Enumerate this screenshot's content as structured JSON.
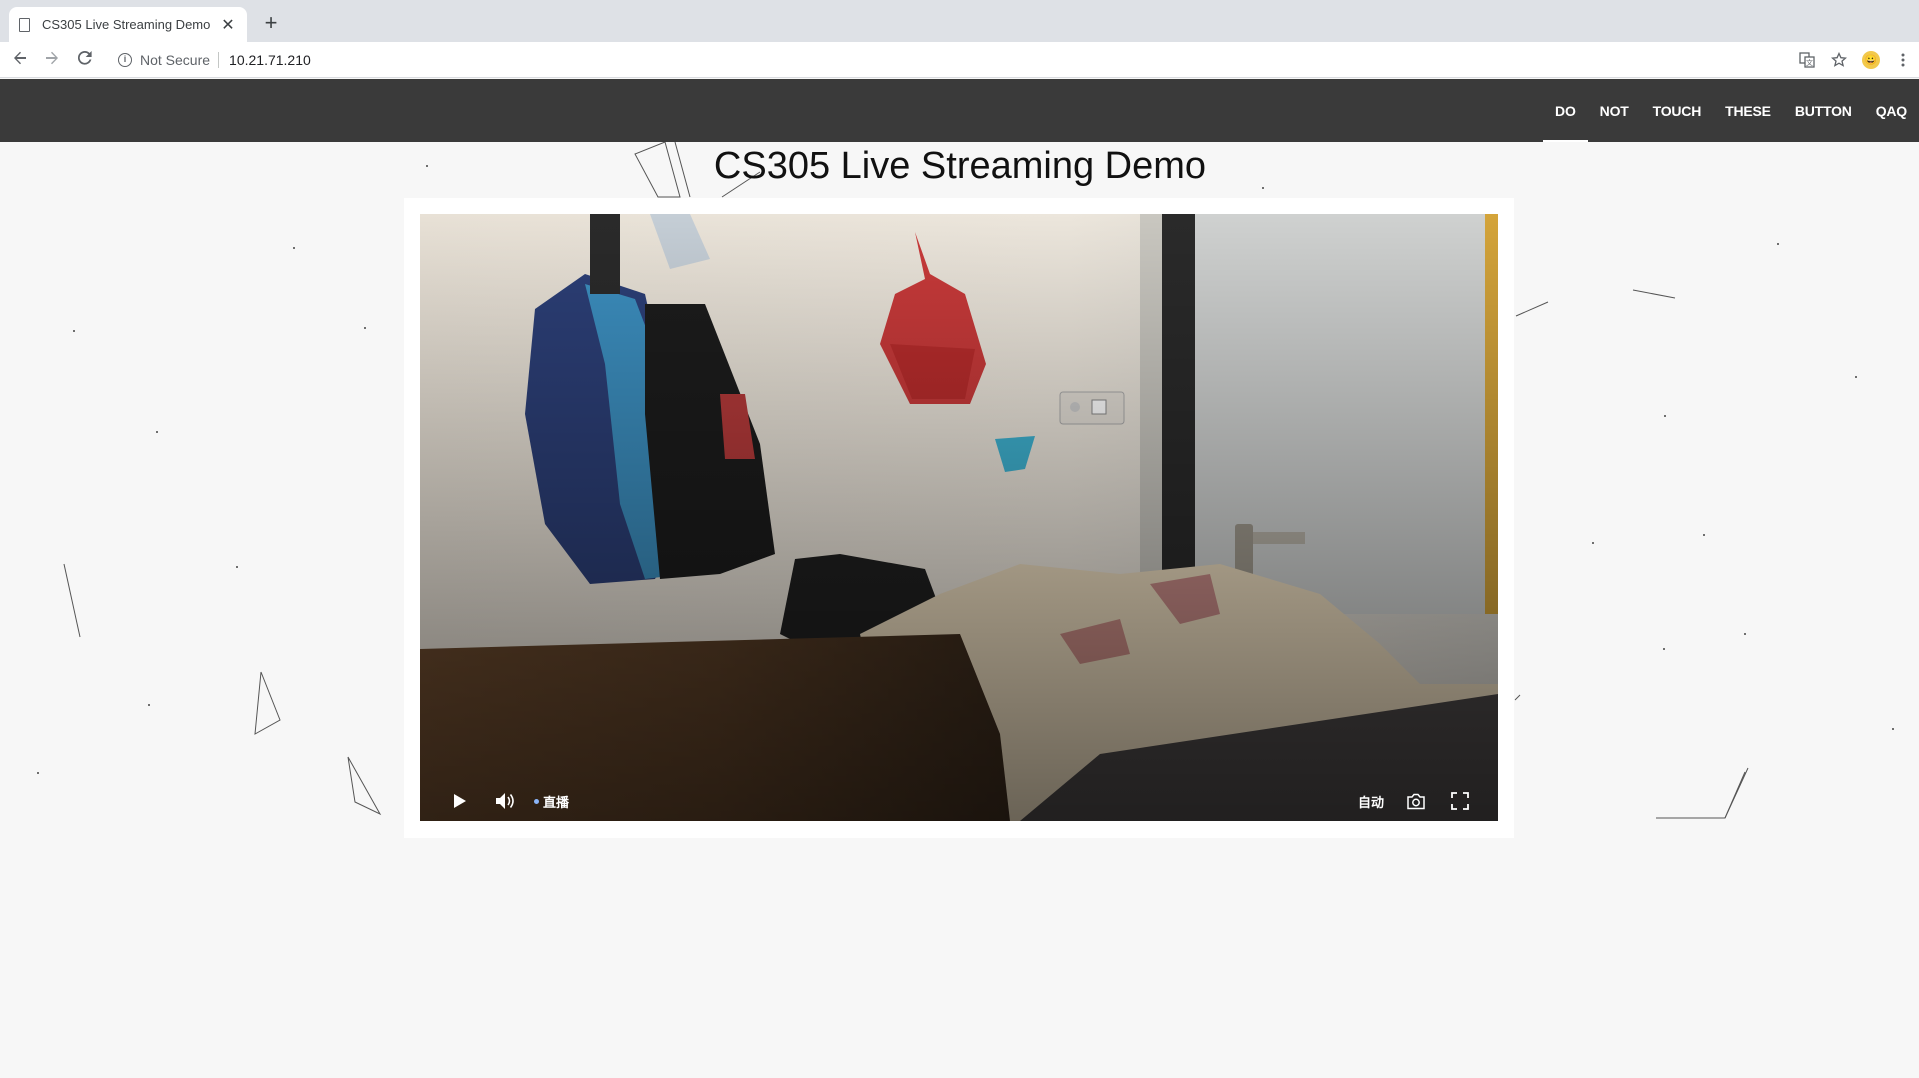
{
  "browser": {
    "tab_title": "CS305 Live Streaming Demo",
    "new_tab_symbol": "+",
    "security_label": "Not Secure",
    "url": "10.21.71.210",
    "icons": [
      "back-icon",
      "forward-icon",
      "reload-icon",
      "info-icon",
      "translate-icon",
      "star-icon",
      "avatar",
      "menu-icon"
    ]
  },
  "site_nav": {
    "items": [
      {
        "label": "DO",
        "active": true
      },
      {
        "label": "NOT",
        "active": false
      },
      {
        "label": "TOUCH",
        "active": false
      },
      {
        "label": "THESE",
        "active": false
      },
      {
        "label": "BUTTON",
        "active": false
      },
      {
        "label": "QAQ",
        "active": false
      }
    ]
  },
  "page": {
    "title": "CS305 Live Streaming Demo"
  },
  "player": {
    "live_label": "直播",
    "quality_label": "自动",
    "icons": [
      "play-icon",
      "volume-icon",
      "screenshot-icon",
      "fullscreen-icon"
    ]
  },
  "colors": {
    "nav_bg": "#3a3a3a",
    "page_bg": "#f7f7f7",
    "chrome_bg": "#dee1e6"
  }
}
